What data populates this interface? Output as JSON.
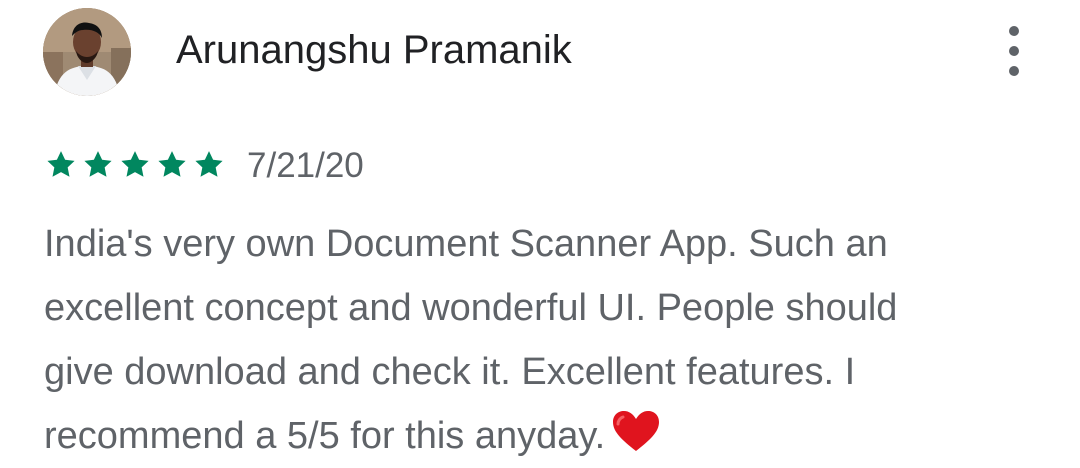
{
  "review": {
    "reviewer_name": "Arunangshu Pramanik",
    "rating": 5,
    "rating_max": 5,
    "date": "7/21/20",
    "body_lines": [
      "India's very own Document Scanner App. Such an",
      "excellent concept and wonderful UI. People should",
      "give download and check it. Excellent features. I",
      "recommend a 5/5 for this anyday."
    ],
    "emoji": "red-heart"
  },
  "colors": {
    "star": "#01875f",
    "name_text": "#202124",
    "secondary_text": "#5f6368",
    "heart": "#e0141e"
  },
  "icons": {
    "menu": "more-vertical-icon",
    "star": "star-icon",
    "emoji": "heart-icon"
  }
}
